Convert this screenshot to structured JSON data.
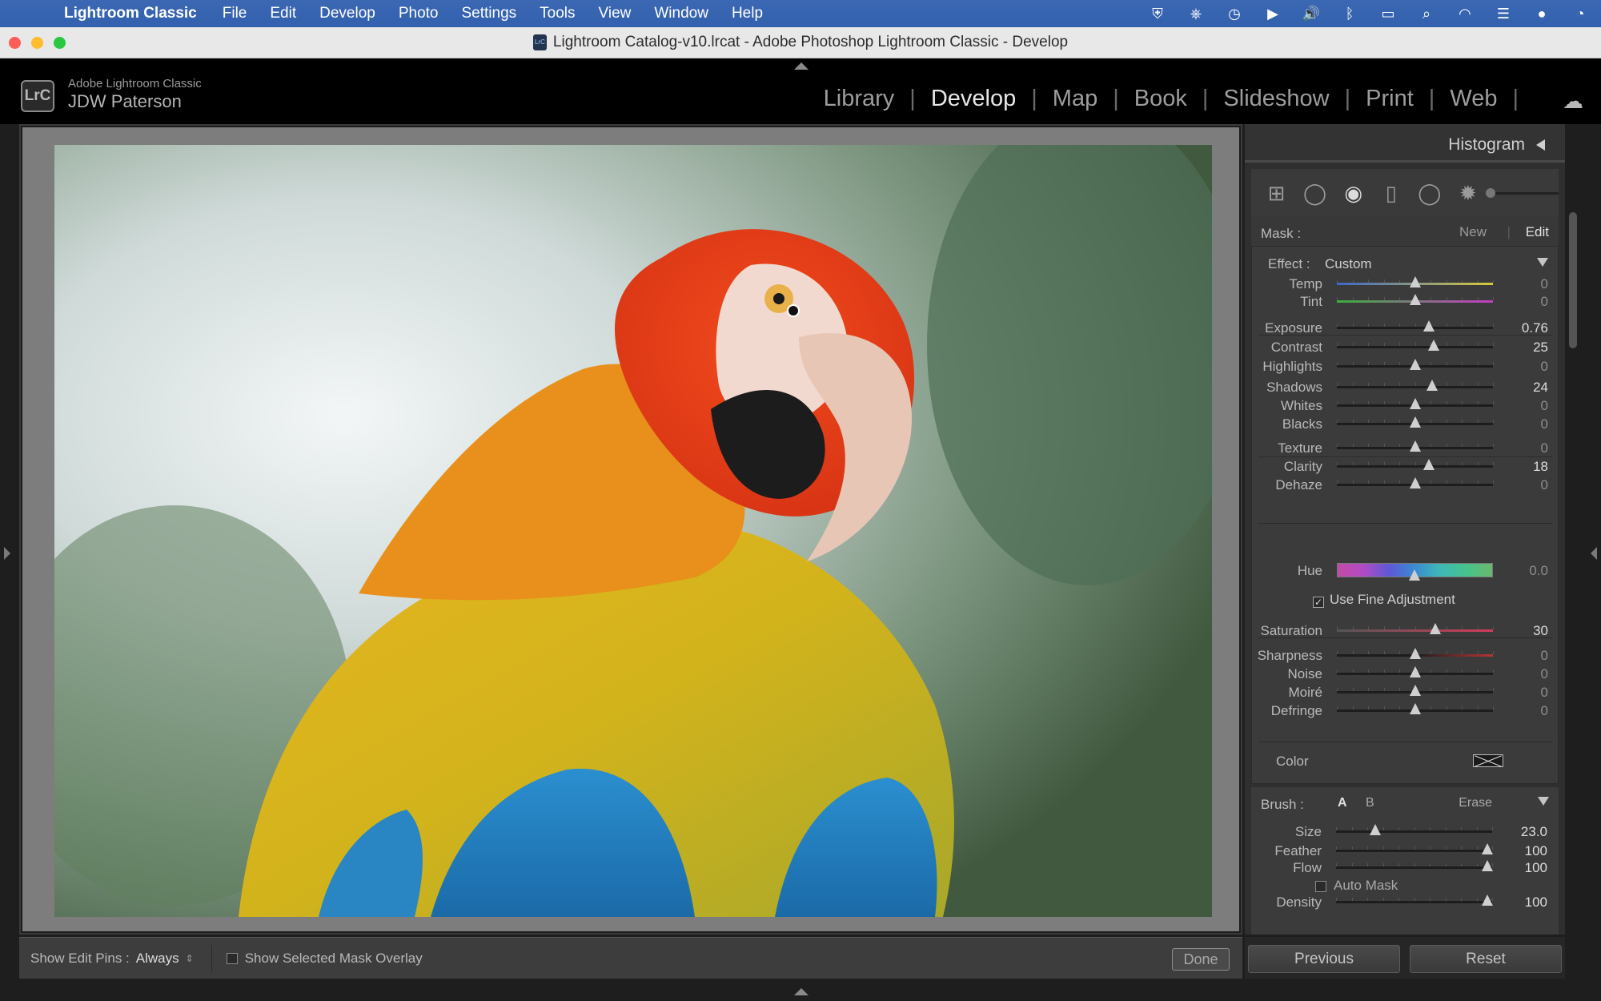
{
  "menubar": {
    "app": "Lightroom Classic",
    "items": [
      "File",
      "Edit",
      "Develop",
      "Photo",
      "Settings",
      "Tools",
      "View",
      "Window",
      "Help"
    ]
  },
  "window": {
    "title": "Lightroom Catalog-v10.lrcat - Adobe Photoshop Lightroom Classic - Develop"
  },
  "identity": {
    "logo": "LrC",
    "line1": "Adobe Lightroom Classic",
    "line2": "JDW Paterson"
  },
  "modules": [
    "Library",
    "Develop",
    "Map",
    "Book",
    "Slideshow",
    "Print",
    "Web"
  ],
  "active_module": "Develop",
  "panel": {
    "header": "Histogram",
    "mask": {
      "label": "Mask :",
      "new": "New",
      "edit": "Edit"
    },
    "effect": {
      "label": "Effect :",
      "value": "Custom"
    },
    "sliders": [
      {
        "label": "Temp",
        "value": "0",
        "pos": 0.5
      },
      {
        "label": "Tint",
        "value": "0",
        "pos": 0.5
      },
      {
        "label": "Exposure",
        "value": "0.76",
        "pos": 0.59
      },
      {
        "label": "Contrast",
        "value": "25",
        "pos": 0.62
      },
      {
        "label": "Highlights",
        "value": "0",
        "pos": 0.5
      },
      {
        "label": "Shadows",
        "value": "24",
        "pos": 0.61
      },
      {
        "label": "Whites",
        "value": "0",
        "pos": 0.5
      },
      {
        "label": "Blacks",
        "value": "0",
        "pos": 0.5
      },
      {
        "label": "Texture",
        "value": "0",
        "pos": 0.5
      },
      {
        "label": "Clarity",
        "value": "18",
        "pos": 0.59
      },
      {
        "label": "Dehaze",
        "value": "0",
        "pos": 0.5
      }
    ],
    "hue": {
      "label": "Hue",
      "value": "0.0",
      "pos": 0.5
    },
    "fine_adjustment": "Use Fine Adjustment",
    "saturation": {
      "label": "Saturation",
      "value": "30",
      "pos": 0.63
    },
    "sliders2": [
      {
        "label": "Sharpness",
        "value": "0",
        "pos": 0.5
      },
      {
        "label": "Noise",
        "value": "0",
        "pos": 0.5
      },
      {
        "label": "Moiré",
        "value": "0",
        "pos": 0.5
      },
      {
        "label": "Defringe",
        "value": "0",
        "pos": 0.5
      }
    ],
    "color_label": "Color",
    "brush": {
      "label": "Brush :",
      "a": "A",
      "b": "B",
      "erase": "Erase",
      "sliders": [
        {
          "label": "Size",
          "value": "23.0",
          "pos": 0.25
        },
        {
          "label": "Feather",
          "value": "100",
          "pos": 0.97
        },
        {
          "label": "Flow",
          "value": "100",
          "pos": 0.97
        }
      ],
      "auto_mask": "Auto Mask",
      "density": {
        "label": "Density",
        "value": "100",
        "pos": 0.97
      }
    }
  },
  "toolbar": {
    "edit_pins_label": "Show Edit Pins :",
    "edit_pins_value": "Always",
    "overlay_label": "Show Selected Mask Overlay",
    "done": "Done"
  },
  "buttons": {
    "previous": "Previous",
    "reset": "Reset"
  }
}
